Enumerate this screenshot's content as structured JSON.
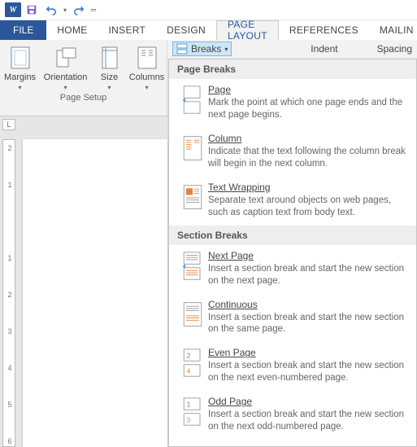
{
  "qat": {
    "app_letter": "W"
  },
  "tabs": {
    "file": "FILE",
    "home": "HOME",
    "insert": "INSERT",
    "design": "DESIGN",
    "page_layout": "PAGE LAYOUT",
    "references": "REFERENCES",
    "mailings": "MAILIN"
  },
  "page_setup": {
    "margins": "Margins",
    "orientation": "Orientation",
    "size": "Size",
    "columns": "Columns",
    "group_label": "Page Setup"
  },
  "breaks_button": "Breaks",
  "indent_label": "Indent",
  "spacing_label": "Spacing",
  "dropdown": {
    "section1": "Page Breaks",
    "items1": [
      {
        "title": "Page",
        "desc": "Mark the point at which one page ends and the next page begins."
      },
      {
        "title": "Column",
        "desc": "Indicate that the text following the column break will begin in the next column."
      },
      {
        "title": "Text Wrapping",
        "desc": "Separate text around objects on web pages, such as caption text from body text."
      }
    ],
    "section2": "Section Breaks",
    "items2": [
      {
        "title": "Next Page",
        "desc": "Insert a section break and start the new section on the next page."
      },
      {
        "title": "Continuous",
        "desc": "Insert a section break and start the new section on the same page."
      },
      {
        "title": "Even Page",
        "desc": "Insert a section break and start the new section on the next even-numbered page."
      },
      {
        "title": "Odd Page",
        "desc": "Insert a section break and start the new section on the next odd-numbered page."
      }
    ]
  },
  "ruler_corner": "L",
  "ruler_marks": [
    "2",
    "1",
    "",
    "1",
    "2",
    "3",
    "4",
    "5",
    "6"
  ]
}
